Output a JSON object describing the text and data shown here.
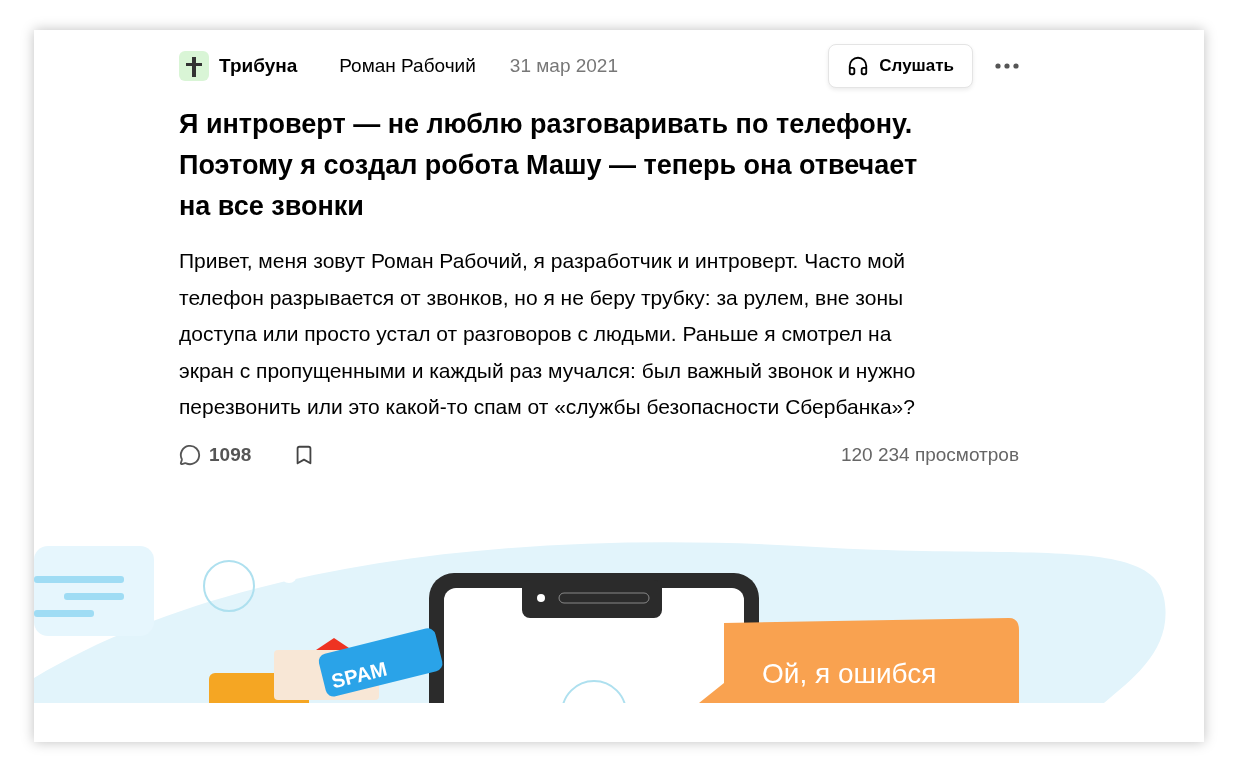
{
  "header": {
    "publication": "Трибуна",
    "author": "Роман Рабочий",
    "date": "31 мар 2021",
    "listen_button": "Слушать"
  },
  "title": "Я интроверт — не люблю разговаривать по телефону. Поэтому я создал робота Машу — теперь она отвечает на все звонки",
  "lead": "Привет, меня зовут Роман Рабочий, я разработчик и интроверт. Часто мой телефон разрывается от звонков, но я не беру трубку: за рулем, вне зоны доступа или просто устал от разговоров с людьми. Раньше я смотрел на экран с пропущенными и каждый раз мучался: был важный звонок и нужно перезвонить или это какой-то спам от «службы безопасности Сбербанка»?",
  "footer": {
    "comments": "1098",
    "bookmarked": false,
    "views": "120 234 просмотров"
  },
  "illustration": {
    "spam_label": "SPAM",
    "speech_bubble": "Ой, я ошибся"
  }
}
